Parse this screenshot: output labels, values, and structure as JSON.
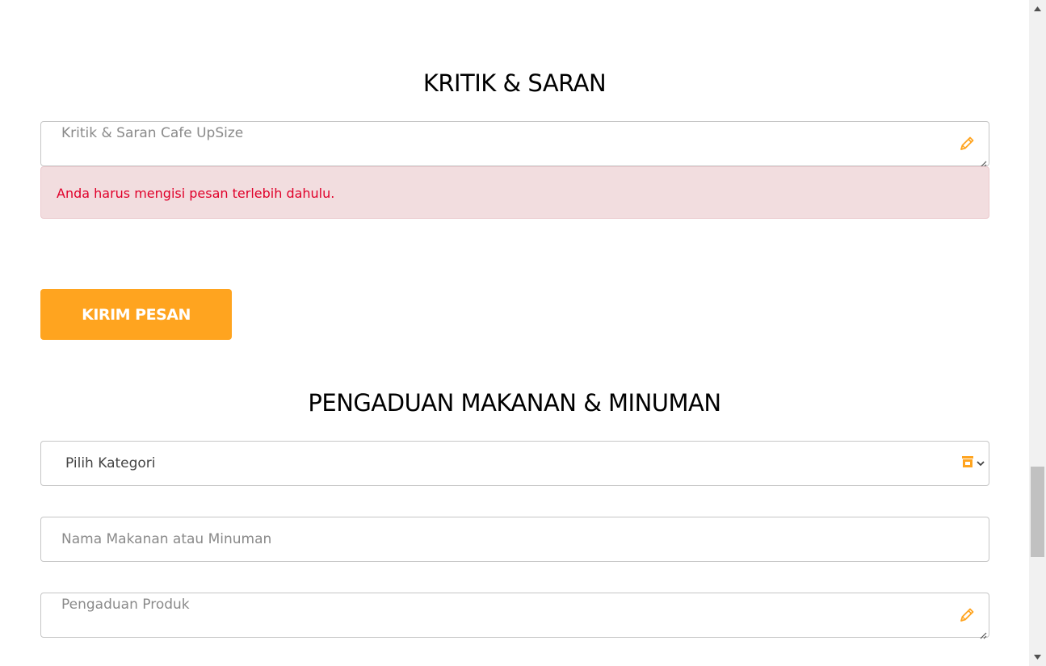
{
  "kritik_section": {
    "title": "KRITIK & SARAN",
    "textarea_placeholder": "Kritik & Saran Cafe UpSize",
    "textarea_value": "",
    "pencil_icon": "pencil-icon",
    "error_message": "Anda harus mengisi pesan terlebih dahulu.",
    "submit_label": "KIRIM PESAN"
  },
  "pengaduan_section": {
    "title": "PENGADUAN MAKANAN & MINUMAN",
    "category_select": {
      "selected": "Pilih Kategori",
      "icon": "store-icon"
    },
    "product_name_placeholder": "Nama Makanan atau Minuman",
    "product_name_value": "",
    "complaint_placeholder": "Pengaduan Produk",
    "complaint_value": ""
  },
  "colors": {
    "accent": "#ffa41f",
    "error_text": "#e0002a",
    "error_bg": "#f2dddf"
  }
}
